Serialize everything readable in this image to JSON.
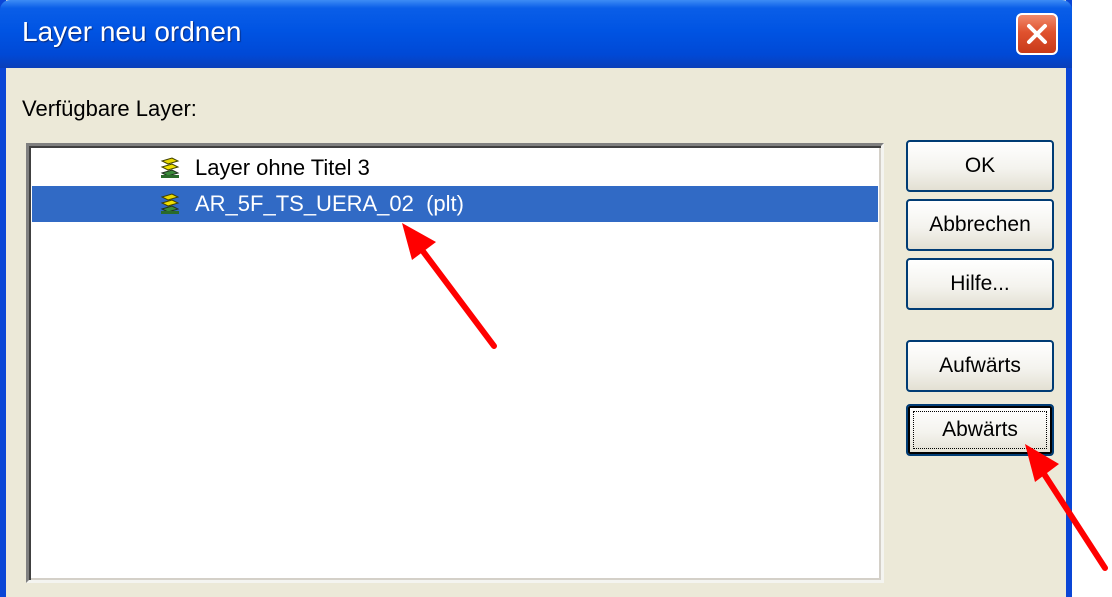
{
  "window": {
    "title": "Layer neu ordnen",
    "close_icon": "close-icon"
  },
  "list": {
    "label": "Verfügbare Layer:",
    "items": [
      {
        "label": "Layer ohne Titel 3",
        "icon": "layer-stack-icon",
        "selected": false
      },
      {
        "label": "AR_5F_TS_UERA_02  (plt)",
        "icon": "layer-stack-icon",
        "selected": true
      }
    ]
  },
  "buttons": {
    "ok": "OK",
    "cancel": "Abbrechen",
    "help": "Hilfe...",
    "up": "Aufwärts",
    "down": "Abwärts"
  },
  "colors": {
    "titlebar": "#0054e3",
    "close": "#e0522e",
    "dialog_bg": "#ece9d8",
    "selection": "#316ac5",
    "annotation_arrow": "#ff0000"
  }
}
